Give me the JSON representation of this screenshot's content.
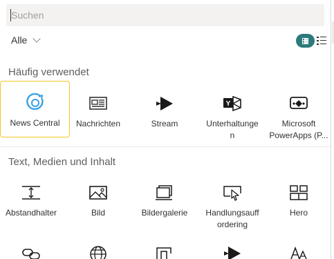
{
  "search": {
    "placeholder": "Suchen",
    "value": ""
  },
  "filter": {
    "label": "Alle"
  },
  "view": {
    "active": "grid",
    "accent": "#2c7a7b"
  },
  "sections": {
    "frequent": {
      "title": "Häufig verwendet"
    },
    "text_media": {
      "title": "Text, Medien und Inhalt"
    }
  },
  "frequent_tiles": [
    {
      "label": "News Central",
      "icon": "news-central-icon",
      "selected": true
    },
    {
      "label": "Nachrichten",
      "icon": "newspaper-icon"
    },
    {
      "label": "Stream",
      "icon": "stream-icon"
    },
    {
      "label": "Unterhaltunge\nn",
      "icon": "conversation-icon"
    },
    {
      "label": "Microsoft\nPowerApps (P...",
      "icon": "powerapps-icon"
    }
  ],
  "text_media_tiles": [
    {
      "label": "Abstandhalter",
      "icon": "spacer-icon"
    },
    {
      "label": "Bild",
      "icon": "image-icon"
    },
    {
      "label": "Bildergalerie",
      "icon": "gallery-icon"
    },
    {
      "label": "Handlungsauff\nordering",
      "icon": "call-to-action-icon"
    },
    {
      "label": "Hero",
      "icon": "hero-icon"
    }
  ],
  "colors": {
    "news_icon": "#3aa0e6",
    "selected_border": "#f3c623"
  }
}
